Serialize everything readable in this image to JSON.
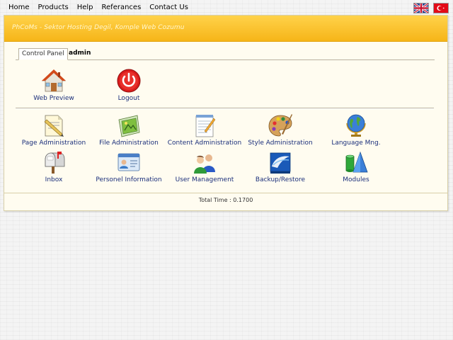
{
  "topnav": {
    "links": [
      "Home",
      "Products",
      "Help",
      "Referances",
      "Contact Us"
    ]
  },
  "flags": [
    {
      "icon": "uk-flag-icon"
    },
    {
      "icon": "turkey-flag-icon"
    }
  ],
  "banner": {
    "text": "PhCoMs - Sektor Hosting Degil, Komple Web Cozumu"
  },
  "tab": {
    "label": "Control Panel",
    "user": "admin"
  },
  "top_actions": [
    {
      "label": "Web Preview",
      "icon": "house-icon"
    },
    {
      "label": "Logout",
      "icon": "power-icon"
    }
  ],
  "modules": [
    {
      "label": "Page Administration",
      "icon": "page-icon"
    },
    {
      "label": "File Administration",
      "icon": "file-icon"
    },
    {
      "label": "Content Administration",
      "icon": "notepad-icon"
    },
    {
      "label": "Style Administration",
      "icon": "palette-icon"
    },
    {
      "label": "Language Mng.",
      "icon": "globe-icon"
    },
    {
      "label": "Inbox",
      "icon": "mailbox-icon"
    },
    {
      "label": "Personel Information",
      "icon": "id-card-icon"
    },
    {
      "label": "User Management",
      "icon": "users-icon"
    },
    {
      "label": "Backup/Restore",
      "icon": "database-icon"
    },
    {
      "label": "Modules",
      "icon": "shapes-icon"
    }
  ],
  "footer": {
    "text": "Total Time : 0.1700"
  }
}
